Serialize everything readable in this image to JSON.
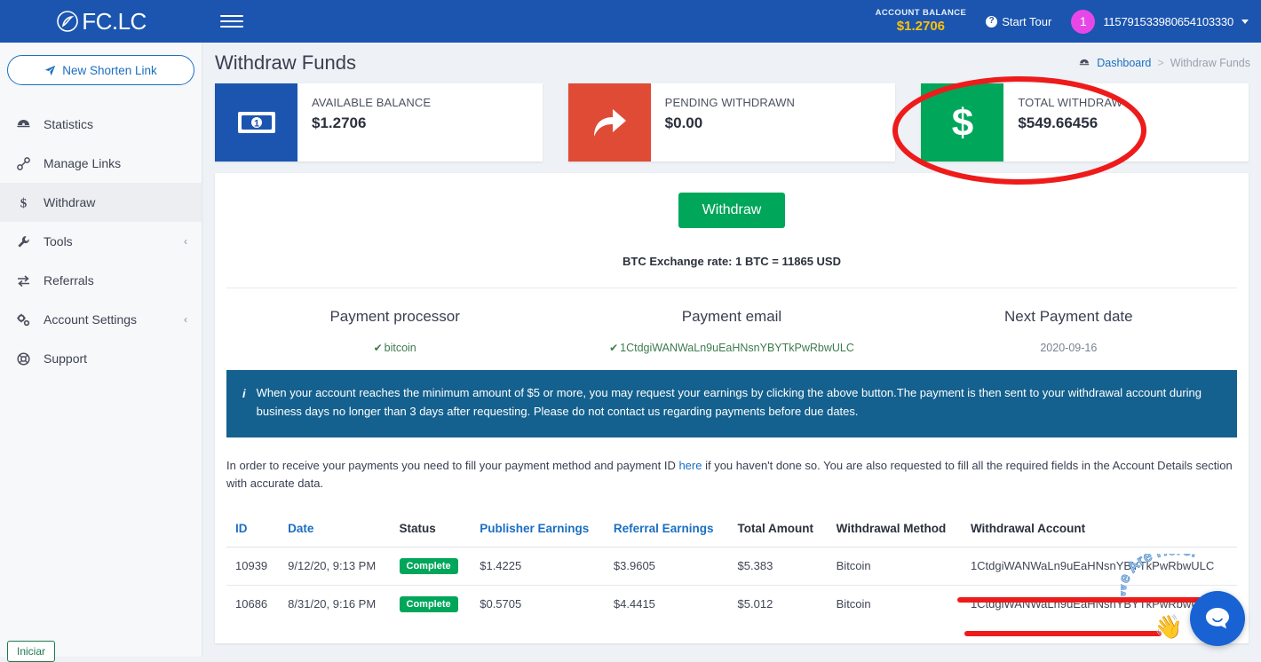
{
  "topbar": {
    "brand": "FC.LC",
    "brand_sub": "",
    "menu_icon": "hamburger-icon",
    "account_balance_label": "ACCOUNT BALANCE",
    "account_balance_value": "$1.2706",
    "start_tour": "Start Tour",
    "avatar_initial": "1",
    "user_id": "115791533980654103330"
  },
  "sidebar": {
    "new_link_button": "New Shorten Link",
    "items": [
      {
        "label": "Statistics",
        "icon": "chart-icon",
        "active": false,
        "chevron": ""
      },
      {
        "label": "Manage Links",
        "icon": "link-icon",
        "active": false,
        "chevron": ""
      },
      {
        "label": "Withdraw",
        "icon": "dollar-icon",
        "active": true,
        "chevron": ""
      },
      {
        "label": "Tools",
        "icon": "wrench-icon",
        "active": false,
        "chevron": "‹"
      },
      {
        "label": "Referrals",
        "icon": "exchange-icon",
        "active": false,
        "chevron": ""
      },
      {
        "label": "Account Settings",
        "icon": "gears-icon",
        "active": false,
        "chevron": "‹"
      },
      {
        "label": "Support",
        "icon": "lifering-icon",
        "active": false,
        "chevron": ""
      }
    ],
    "iniciar_button": "Iniciar"
  },
  "page": {
    "title": "Withdraw Funds",
    "breadcrumb_home": "Dashboard",
    "breadcrumb_sep": ">",
    "breadcrumb_current": "Withdraw Funds"
  },
  "cards": [
    {
      "label": "AVAILABLE BALANCE",
      "value": "$1.2706",
      "icon": "money-bill-icon",
      "color": "#1b55af"
    },
    {
      "label": "PENDING WITHDRAWN",
      "value": "$0.00",
      "icon": "share-arrow-icon",
      "color": "#e04b35"
    },
    {
      "label": "TOTAL WITHDRAW",
      "value": "$549.66456",
      "icon": "dollar-sign-icon",
      "color": "#00a65a"
    }
  ],
  "panel": {
    "withdraw_button": "Withdraw",
    "btc_rate": "BTC Exchange rate: 1 BTC = 11865 USD",
    "payment": {
      "processor_head": "Payment processor",
      "processor_value": "bitcoin",
      "email_head": "Payment email",
      "email_value": "1CtdgiWANWaLn9uEaHNsnYBYTkPwRbwULC",
      "date_head": "Next Payment date",
      "date_value": "2020-09-16"
    },
    "alert_icon": "info-icon",
    "alert_text": "When your account reaches the minimum amount of $5 or more, you may request your earnings by clicking the above button.The payment is then sent to your withdrawal account during business days no longer than 3 days after requesting. Please do not contact us regarding payments before due dates.",
    "note_part1": "In order to receive your payments you need to fill your payment method and payment ID ",
    "note_link": "here",
    "note_part2": " if you haven't done so. You are also requested to fill all the required fields in the Account Details section with accurate data."
  },
  "table": {
    "headers": [
      {
        "label": "ID",
        "sortable": true
      },
      {
        "label": "Date",
        "sortable": true
      },
      {
        "label": "Status",
        "sortable": false
      },
      {
        "label": "Publisher Earnings",
        "sortable": true
      },
      {
        "label": "Referral Earnings",
        "sortable": true
      },
      {
        "label": "Total Amount",
        "sortable": false
      },
      {
        "label": "Withdrawal Method",
        "sortable": false
      },
      {
        "label": "Withdrawal Account",
        "sortable": false
      }
    ],
    "rows": [
      {
        "id": "10939",
        "date": "9/12/20, 9:13 PM",
        "status": "Complete",
        "publisher_earnings": "$1.4225",
        "referral_earnings": "$3.9605",
        "total_amount": "$5.383",
        "method": "Bitcoin",
        "account": "1CtdgiWANWaLn9uEaHNsnYBYTkPwRbwULC"
      },
      {
        "id": "10686",
        "date": "8/31/20, 9:16 PM",
        "status": "Complete",
        "publisher_earnings": "$0.5705",
        "referral_earnings": "$4.4415",
        "total_amount": "$5.012",
        "method": "Bitcoin",
        "account": "1CtdgiWANWaLn9uEaHNsnYBYTkPwRbwULC"
      }
    ]
  },
  "chat": {
    "bubble_icon": "chat-bubble-icon",
    "tagline": "We Are Here!",
    "wave": "👋"
  },
  "annotations": {
    "ellipse_color": "#ee1b1b",
    "strike_color": "#ee1b1b"
  }
}
